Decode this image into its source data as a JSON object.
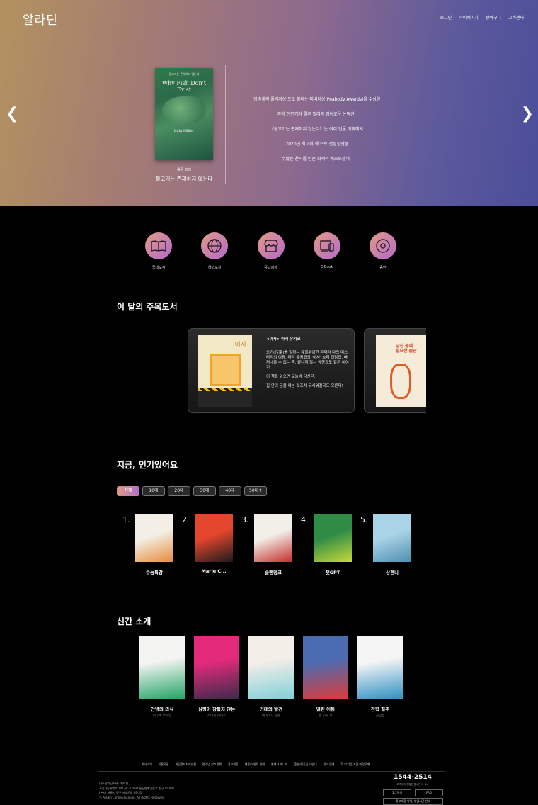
{
  "header": {
    "logo": "알라딘",
    "nav": [
      "로그인",
      "마이페이지",
      "장바구니",
      "고객센터"
    ]
  },
  "hero": {
    "cover_top_text": "물고기는 존재하지 않는다",
    "cover_title": "Why Fish Don't Exist",
    "cover_author": "Lulu Miller",
    "author": "룰루 밀러",
    "title": "물고기는 존재하지 않는다",
    "description": [
      "'방송계의 퓰리처상'으로 불리는 피버디상(Peabody Awards)을 수상한",
      "과학 전문기자 룰루 밀러의 경이로운 논픽션.",
      "《물고기는 존재하지 않는다》는 여러 언론 매체에서",
      "'2020년 최고의 책'으로 선정될만큼",
      "수많은 찬사를 받은 화제의 베스트셀러."
    ]
  },
  "categories": [
    {
      "label": "국내도서",
      "icon": "book-icon"
    },
    {
      "label": "해외도서",
      "icon": "globe-icon"
    },
    {
      "label": "중고매장",
      "icon": "store-icon"
    },
    {
      "label": "E-Book",
      "icon": "device-icon"
    },
    {
      "label": "음반",
      "icon": "disc-icon"
    }
  ],
  "book_of_month": {
    "section_title": "이 달의 주목도서",
    "cover_title": "이사",
    "card_title": "<이사> 마리 유키코",
    "paragraphs": [
      "오기(汚家)를 말하는 유일무이한 존재라 다크 미스터리의 여왕, 마리 유키코의 '이사' 호러 괴담집. 빠져나올 수 없는 혼, 끝나지 않는 악몽과도 같은 이야기",
      "이 책을 읽으면 오늘밤 당신은,",
      "집 안의 문을 여는 것조차 무서워질지도 모른다!"
    ],
    "second_cover_title": "당신 몸에 필요한 습관"
  },
  "popular": {
    "section_title": "지금, 인기있어요",
    "tabs": [
      "전체",
      "10대",
      "20대",
      "30대",
      "40대",
      "50대↑"
    ],
    "active_tab": 0,
    "items": [
      {
        "rank": "1.",
        "title": "수능특강",
        "colors": [
          "#f4efe6",
          "#e58a3a"
        ]
      },
      {
        "rank": "2.",
        "title": "Marie C...",
        "colors": [
          "#e4452d",
          "#1b1b1b"
        ]
      },
      {
        "rank": "3.",
        "title": "슬램덩크",
        "colors": [
          "#f2efe8",
          "#c32d2a"
        ]
      },
      {
        "rank": "4.",
        "title": "챗GPT",
        "colors": [
          "#2f8c46",
          "#c8d83a"
        ]
      },
      {
        "rank": "5.",
        "title": "상견니",
        "colors": [
          "#a9d3e6",
          "#4d8fb0"
        ]
      }
    ]
  },
  "new_releases": {
    "section_title": "신간 소개",
    "items": [
      {
        "title": "안녕의 의식",
        "author": "이다혜 외 8인",
        "colors": [
          "#f4f4f2",
          "#21a365"
        ]
      },
      {
        "title": "심령이 잠들지 않는",
        "author": "조너선 해리스",
        "colors": [
          "#e32a7b",
          "#3b2a4a"
        ]
      },
      {
        "title": "기대의 발견",
        "author": "데이비드 롭슨",
        "colors": [
          "#f3eee8",
          "#7fd0d8"
        ]
      },
      {
        "title": "열린 어둠",
        "author": "켄 리우 외",
        "colors": [
          "#4a6bb0",
          "#e03a3a"
        ]
      },
      {
        "title": "전력 질주",
        "author": "김민정",
        "colors": [
          "#f5f5f5",
          "#2c8fc2"
        ]
      }
    ]
  },
  "footer": {
    "links": [
      "회사소개",
      "이용약관",
      "개인정보처리방침",
      "청소년 보호정책",
      "광고제휴",
      "채용/이벤트 안내",
      "판매자 매니저",
      "출판사/공급사 안내",
      "광고 안내",
      "학교/기업/기관 대량구매"
    ],
    "info": [
      "(주) 알라딘커뮤니케이션",
      "사업자등록번호 201-81-23094 통신판매업신고 중구-1520호",
      "(본사) 서울시 중구 서소문로 89-31",
      "ⓒ Aladin Communication. All Rights Reserved."
    ],
    "phone": "1544-2514",
    "phone_sub": "고객센터 평일운영시간 9~6시",
    "buttons": [
      "1:1문의",
      "FAQ",
      "중고매장 위치, 영업시간 안내"
    ]
  }
}
